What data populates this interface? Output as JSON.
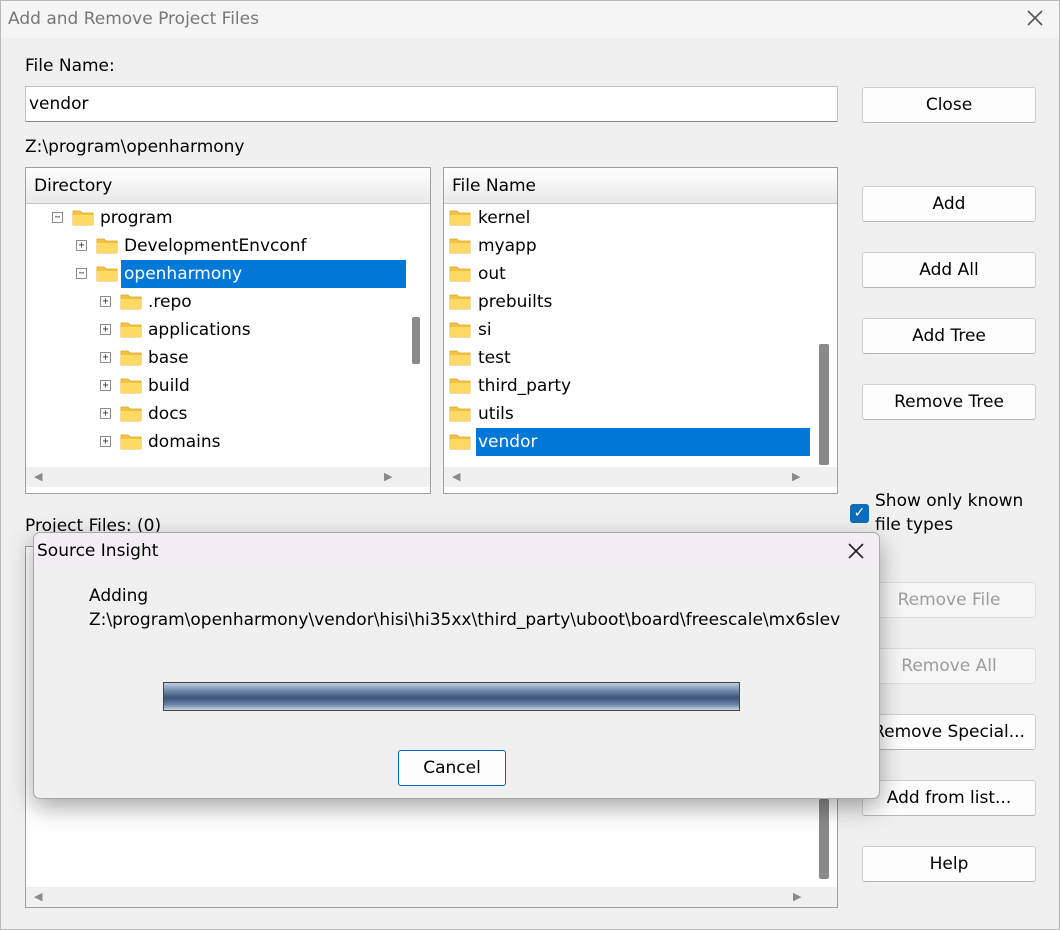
{
  "window": {
    "title": "Add and Remove Project Files"
  },
  "file_name": {
    "label": "File Name:",
    "value": "vendor"
  },
  "current_path": "Z:\\program\\openharmony",
  "directory": {
    "header": "Directory",
    "items": [
      {
        "label": "program",
        "toggle": "−"
      },
      {
        "label": "DevelopmentEnvconf",
        "toggle": "+"
      },
      {
        "label": "openharmony",
        "toggle": "−",
        "selected": true
      },
      {
        "label": ".repo",
        "toggle": "+"
      },
      {
        "label": "applications",
        "toggle": "+"
      },
      {
        "label": "base",
        "toggle": "+"
      },
      {
        "label": "build",
        "toggle": "+"
      },
      {
        "label": "docs",
        "toggle": "+"
      },
      {
        "label": "domains",
        "toggle": "+"
      }
    ]
  },
  "file_list": {
    "header": "File Name",
    "items": [
      "kernel",
      "myapp",
      "out",
      "prebuilts",
      "si",
      "test",
      "third_party",
      "utils",
      "vendor"
    ],
    "selected": "vendor"
  },
  "project_files": {
    "label": "Project Files: (0)"
  },
  "options": {
    "show_known_label_1": "Show only known",
    "show_known_label_2": "file types",
    "show_known_checked": true
  },
  "buttons": {
    "close": "Close",
    "add": "Add",
    "add_all": "Add All",
    "add_tree": "Add Tree",
    "remove_tree": "Remove Tree",
    "remove_file": "Remove File",
    "remove_all": "Remove All",
    "remove_special": "Remove Special...",
    "add_from_list": "Add from list...",
    "help": "Help"
  },
  "progress_dialog": {
    "title": "Source Insight",
    "action": "Adding",
    "path": "Z:\\program\\openharmony\\vendor\\hisi\\hi35xx\\third_party\\uboot\\board\\freescale\\mx6slev",
    "progress_fraction": 1.0,
    "cancel": "Cancel"
  },
  "colors": {
    "selection": "#0078d7",
    "checkbox": "#0f6cbd"
  },
  "icons": {
    "folder": "folder-icon",
    "close": "close-icon"
  }
}
